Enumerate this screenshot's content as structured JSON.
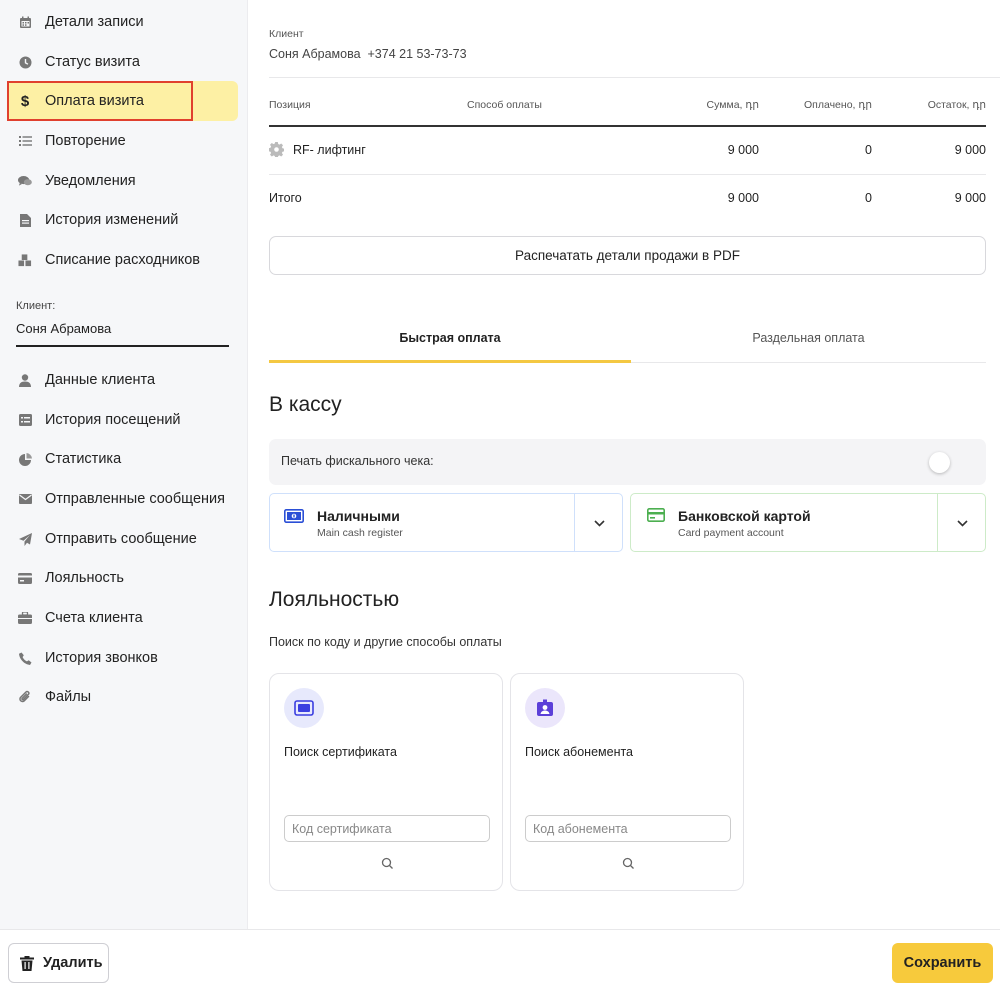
{
  "sidebar": {
    "items": [
      {
        "label": "Детали записи",
        "icon": "calendar-icon"
      },
      {
        "label": "Статус визита",
        "icon": "clock-icon"
      },
      {
        "label": "Оплата визита",
        "icon": "dollar-icon",
        "active": true
      },
      {
        "label": "Повторение",
        "icon": "list-icon"
      },
      {
        "label": "Уведомления",
        "icon": "chat-icon"
      },
      {
        "label": "История изменений",
        "icon": "document-icon"
      },
      {
        "label": "Списание расходников",
        "icon": "cubes-icon"
      }
    ],
    "client": {
      "label": "Клиент:",
      "name": "Соня Абрамова"
    },
    "client_items": [
      {
        "label": "Данные клиента",
        "icon": "user-icon"
      },
      {
        "label": "История посещений",
        "icon": "history-list-icon"
      },
      {
        "label": "Статистика",
        "icon": "pie-chart-icon"
      },
      {
        "label": "Отправленные сообщения",
        "icon": "envelope-icon"
      },
      {
        "label": "Отправить сообщение",
        "icon": "paper-plane-icon"
      },
      {
        "label": "Лояльность",
        "icon": "credit-card-icon"
      },
      {
        "label": "Счета клиента",
        "icon": "briefcase-icon"
      },
      {
        "label": "История звонков",
        "icon": "phone-icon"
      },
      {
        "label": "Файлы",
        "icon": "paperclip-icon"
      }
    ]
  },
  "main": {
    "client_label": "Клиент",
    "client_name": "Соня Абрамова",
    "client_phone": "+374 21 53-73-73",
    "table": {
      "headers": [
        "Позиция",
        "Способ оплаты",
        "Сумма, դր",
        "Оплачено, դր",
        "Остаток, դր"
      ],
      "rows": [
        {
          "position": "RF- лифтинг",
          "icon": "gear-icon",
          "method": "",
          "sum": "9 000",
          "paid": "0",
          "remaining": "9 000"
        }
      ],
      "total": {
        "label": "Итого",
        "sum": "9 000",
        "paid": "0",
        "remaining": "9 000"
      }
    },
    "pdf_button": "Распечатать детали продажи в PDF",
    "tabs": [
      {
        "label": "Быстрая оплата",
        "active": true
      },
      {
        "label": "Раздельная оплата",
        "active": false
      }
    ],
    "cash_section": {
      "title": "В кассу",
      "fiscal_label": "Печать фискального чека:",
      "fiscal_enabled": false,
      "methods": [
        {
          "title": "Наличными",
          "subtitle": "Main cash register",
          "icon": "cash-icon",
          "color": "#2b4fd6"
        },
        {
          "title": "Банковской картой",
          "subtitle": "Card payment account",
          "icon": "bank-card-icon",
          "color": "#4caf50"
        }
      ]
    },
    "loyalty": {
      "title": "Лояльностью",
      "subtitle": "Поиск по коду и другие способы оплаты",
      "cards": [
        {
          "title": "Поиск сертификата",
          "placeholder": "Код сертификата",
          "icon": "certificate-icon",
          "color": "#3b3fe0"
        },
        {
          "title": "Поиск абонемента",
          "placeholder": "Код абонемента",
          "icon": "membership-badge-icon",
          "color": "#5b3fd8"
        }
      ]
    }
  },
  "footer": {
    "delete_label": "Удалить",
    "save_label": "Сохранить"
  },
  "colors": {
    "accent_yellow": "#f7ca3c",
    "active_nav_bg": "#fdf0a4",
    "highlight_outline": "#e0402e"
  }
}
